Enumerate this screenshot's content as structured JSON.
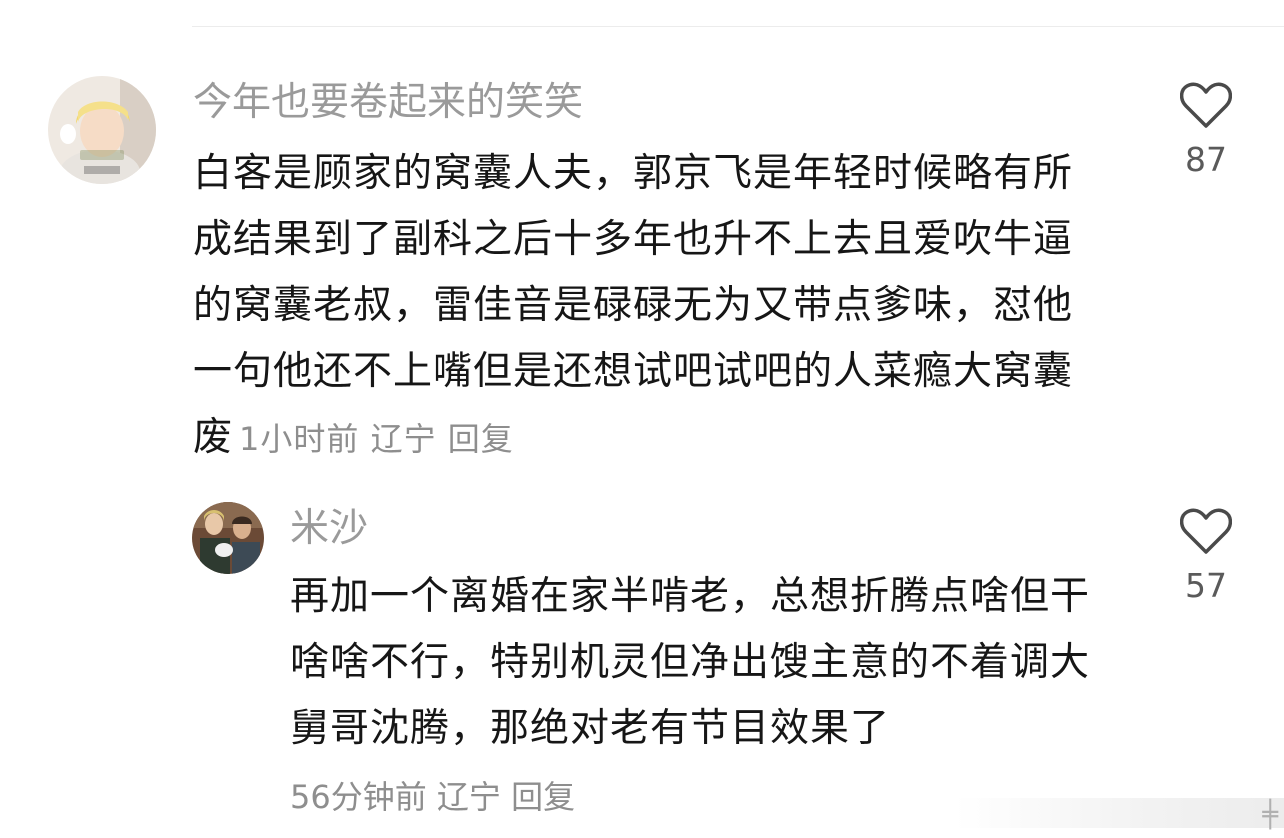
{
  "comments": [
    {
      "author": "今年也要卷起来的笑笑",
      "text": "白客是顾家的窝囊人夫，郭京飞是年轻时候略有所成结果到了副科之后十多年也升不上去且爱吹牛逼的窝囊老叔，雷佳音是碌碌无为又带点爹味，怼他一句他还不上嘴但是还想试吧试吧的人菜瘾大窝囊废",
      "time": "1小时前",
      "location": "辽宁",
      "reply_label": "回复",
      "likes": "87",
      "avatar_icon": "avatar-blond-person-icon",
      "like_icon": "heart-outline-icon"
    },
    {
      "author": "米沙",
      "text": "再加一个离婚在家半啃老，总想折腾点啥但干啥啥不行，特别机灵但净出馊主意的不着调大舅哥沈腾，那绝对老有节目效果了",
      "time": "56分钟前",
      "location": "辽宁",
      "reply_label": "回复",
      "likes": "57",
      "avatar_icon": "avatar-photo-people-icon",
      "like_icon": "heart-outline-icon"
    }
  ],
  "watermark_glyph": "╪",
  "colors": {
    "author": "#9a9a9a",
    "meta": "#8e8e8e",
    "text": "#161616",
    "icon": "#4a4a4a"
  }
}
